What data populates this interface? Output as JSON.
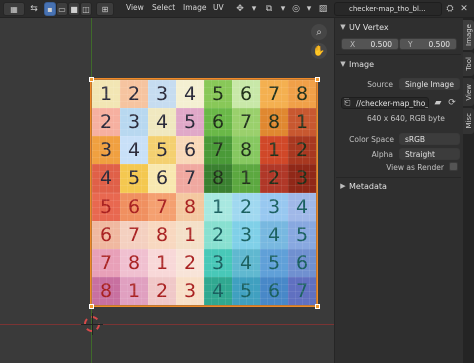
{
  "header": {
    "menus": [
      "View",
      "Select",
      "Image",
      "UV"
    ],
    "image_name": "checker-map_tho_bl..."
  },
  "sidebar": {
    "tabs": [
      "Image",
      "Tool",
      "View",
      "Misc"
    ],
    "uv_vertex": {
      "title": "UV Vertex",
      "x_label": "X",
      "x_value": "0.500",
      "y_label": "Y",
      "y_value": "0.500"
    },
    "image": {
      "title": "Image",
      "source_label": "Source",
      "source_value": "Single Image",
      "filepath": "//checker-map_tho_b...",
      "info": "640 x 640,  RGB byte",
      "color_space_label": "Color Space",
      "color_space_value": "sRGB",
      "alpha_label": "Alpha",
      "alpha_value": "Straight",
      "view_as_render_label": "View as Render"
    },
    "metadata": {
      "title": "Metadata"
    }
  },
  "checker": {
    "rows": [
      [
        "1",
        "2",
        "3",
        "4",
        "5",
        "6",
        "7",
        "8"
      ],
      [
        "2",
        "3",
        "4",
        "5",
        "6",
        "7",
        "8",
        "1"
      ],
      [
        "3",
        "4",
        "5",
        "6",
        "7",
        "8",
        "1",
        "2"
      ],
      [
        "4",
        "5",
        "6",
        "7",
        "8",
        "1",
        "2",
        "3"
      ],
      [
        "5",
        "6",
        "7",
        "8",
        "1",
        "2",
        "3",
        "4"
      ],
      [
        "6",
        "7",
        "8",
        "1",
        "2",
        "3",
        "4",
        "5"
      ],
      [
        "7",
        "8",
        "1",
        "2",
        "3",
        "4",
        "5",
        "6"
      ],
      [
        "8",
        "1",
        "2",
        "3",
        "4",
        "5",
        "6",
        "7"
      ]
    ]
  },
  "colors": {
    "accent": "#4772b3",
    "selection": "#f29a2e"
  }
}
